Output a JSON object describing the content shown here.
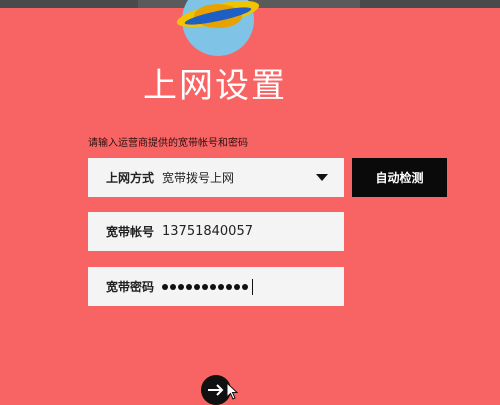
{
  "header": {
    "title": "上网设置"
  },
  "form": {
    "instruction": "请输入运营商提供的宽带帐号和密码",
    "connection_type": {
      "label": "上网方式",
      "value": "宽带拨号上网"
    },
    "account": {
      "label": "宽带帐号",
      "value": "13751840057"
    },
    "password": {
      "label": "宽带密码",
      "mask_length": 11
    },
    "detect_button_label": "自动检测"
  },
  "icons": {
    "logo": "planet-logo-icon",
    "dropdown": "chevron-down-icon",
    "next": "arrow-right-icon",
    "cursor": "mouse-pointer-icon"
  },
  "colors": {
    "background": "#f86464",
    "field_background": "#f4f4f4",
    "button_background": "#0a0a0a",
    "text_light": "#ffffff"
  }
}
